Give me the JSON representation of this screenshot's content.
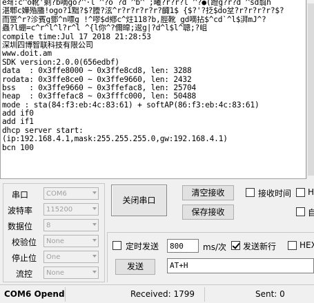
{
  "terminal": {
    "lines": [
      "e쇄:c^o靴'剩?b嘀go?^·l ^?o ?d ^b^ ;曦?r?r?l ^?●(蹬g?r?d ^sd翦h",
      "湛郫c嬅殙膰!ogo?1黜?$?謄?泫^r?r?r?r?r?齱1$ {$?'?抸$do坌?r?r?r?r?$?",
      "而箮^r?沴賓g鄧^n嘌g !^嘐$d鄕c^炷118?b,脛靴 gd嘀拈$^cd`^l$湃mJ^?",
      "蟲?l綳=c^r^l^l?r^l ^{l你^?儞皥;逡g|?d^l$l^聰;?岨",
      "compile time:Jul 17 2018 21:28:53",
      "深圳四博智联科技有限公司",
      "www.doit.am",
      "SDK version:2.0.0(656edbf)",
      "data  : 0x3ffe8000 ~ 0x3ffe8cd8, len: 3288",
      "rodata: 0x3ffe8ce0 ~ 0x3ffe9660, len: 2432",
      "bss   : 0x3ffe9660 ~ 0x3ffefac8, len: 25704",
      "heap  : 0x3ffefac8 ~ 0x3fffc000, len: 50488",
      "mode : sta(84:f3:eb:4c:83:61) + softAP(86:f3:eb:4c:83:61)",
      "add if0",
      "add if1",
      "dhcp server start:",
      "(ip:192.168.4.1,mask:255.255.255.0,gw:192.168.4.1)",
      "bcn 100"
    ]
  },
  "settings": {
    "port_label": "串口",
    "port_value": "COM6",
    "baud_label": "波特率",
    "baud_value": "115200",
    "databits_label": "数据位",
    "databits_value": "8",
    "parity_label": "校验位",
    "parity_value": "None",
    "stopbits_label": "停止位",
    "stopbits_value": "One",
    "flow_label": "流控",
    "flow_value": "None"
  },
  "controls": {
    "open_close_label": "关闭串口",
    "clear_rx_label": "清空接收",
    "save_rx_label": "保存接收",
    "rx_time_label": "接收时间",
    "hex_display_label": "HE",
    "auto_wrap_label": "自",
    "timed_send_label": "定时发送",
    "timed_interval": "800",
    "interval_unit": "ms/次",
    "newline_label": "发送新行",
    "hex_send_label": "HEX",
    "send_label": "发送",
    "send_text": "AT+H"
  },
  "status": {
    "port_state": "COM6 Opend",
    "received": "Received: 1799",
    "sent": "Sent: 0"
  },
  "colors": {
    "window_bg": "#f0f0f0",
    "terminal_bg": "#ffffff"
  }
}
